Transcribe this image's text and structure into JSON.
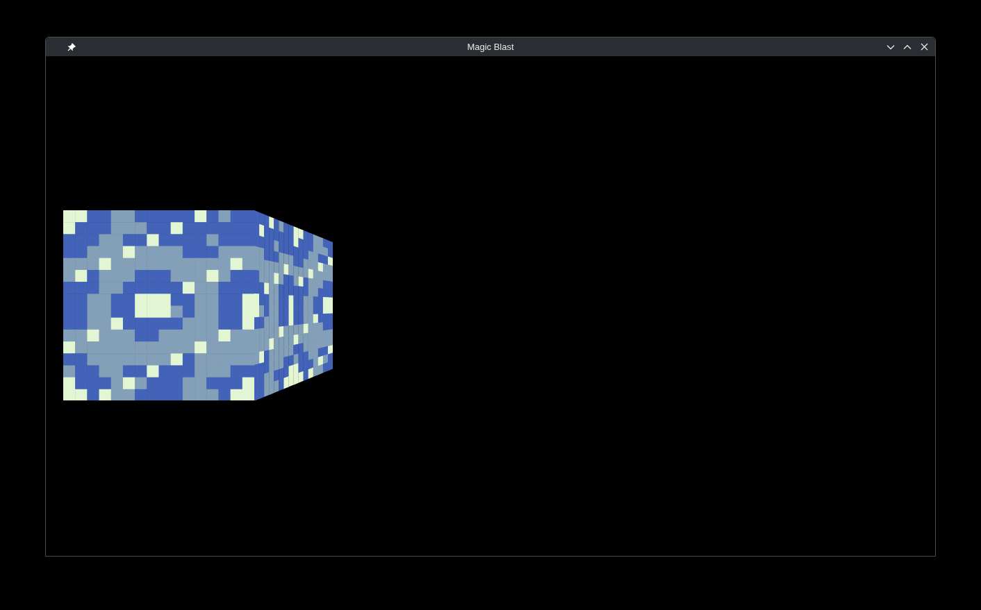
{
  "window": {
    "title": "Magic Blast"
  }
}
